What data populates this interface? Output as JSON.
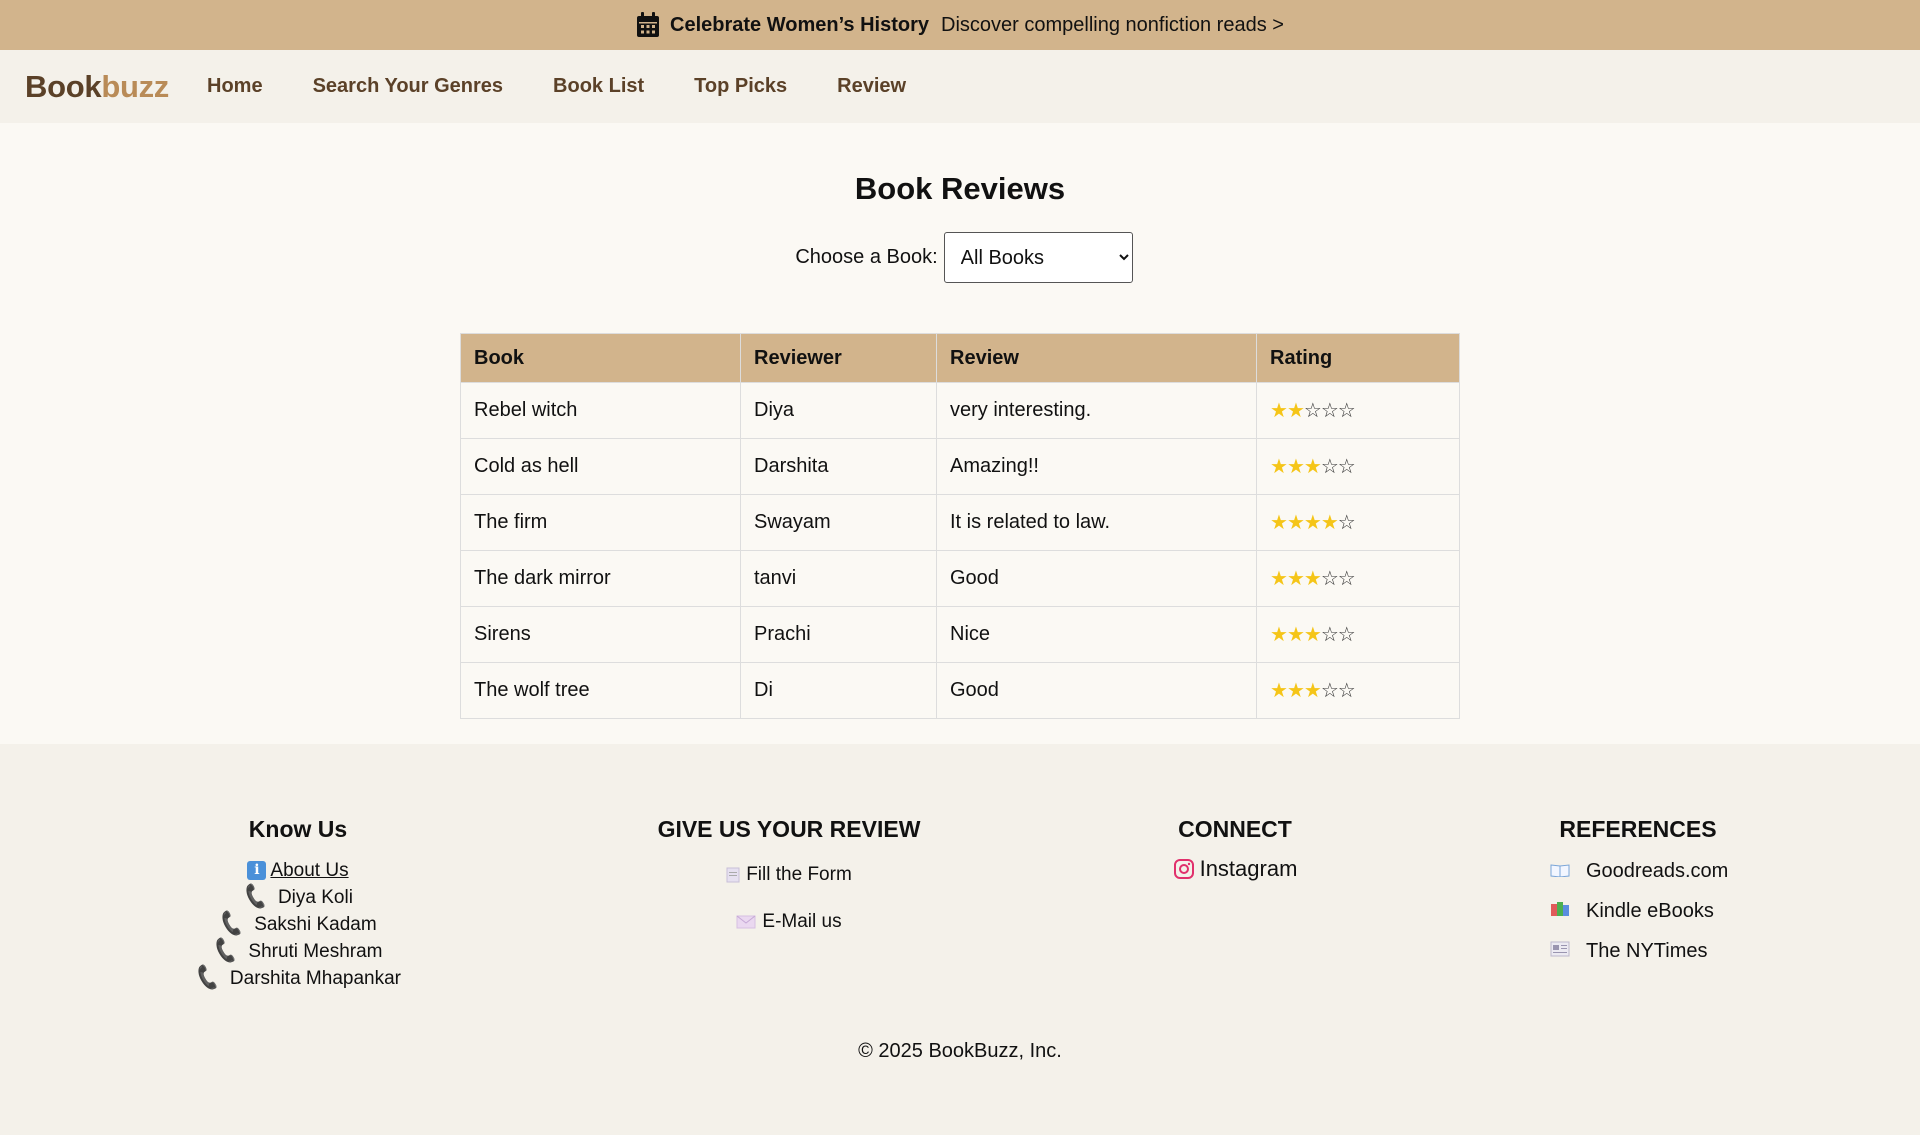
{
  "announcement": {
    "icon": "calendar-icon",
    "title": "Celebrate Women’s History",
    "link_text": "Discover compelling nonfiction reads >"
  },
  "nav": {
    "logo_part1": "Book",
    "logo_part2": "buzz",
    "links": [
      "Home",
      "Search Your Genres",
      "Book List",
      "Top Picks",
      "Review"
    ]
  },
  "main": {
    "title": "Book Reviews",
    "chooser_label": "Choose a Book:",
    "chooser_selected": "All Books"
  },
  "table": {
    "headers": [
      "Book",
      "Reviewer",
      "Review",
      "Rating"
    ],
    "rows": [
      {
        "book": "Rebel witch",
        "reviewer": "Diya",
        "review": "very interesting.",
        "rating": 2
      },
      {
        "book": "Cold as hell",
        "reviewer": "Darshita",
        "review": "Amazing!!",
        "rating": 3
      },
      {
        "book": "The firm",
        "reviewer": "Swayam",
        "review": "It is related to law.",
        "rating": 4
      },
      {
        "book": "The dark mirror",
        "reviewer": "tanvi",
        "review": "Good",
        "rating": 3
      },
      {
        "book": "Sirens",
        "reviewer": "Prachi",
        "review": "Nice",
        "rating": 3
      },
      {
        "book": "The wolf tree",
        "reviewer": "Di",
        "review": "Good",
        "rating": 3
      }
    ],
    "max_rating": 5
  },
  "footer": {
    "know_us": {
      "title": "Know Us",
      "about": "About Us",
      "people": [
        "Diya Koli",
        "Sakshi Kadam",
        "Shruti Meshram",
        "Darshita Mhapankar"
      ]
    },
    "review": {
      "title": "GIVE US YOUR REVIEW",
      "form": "Fill the Form",
      "email": "E-Mail us"
    },
    "connect": {
      "title": "CONNECT",
      "instagram": "Instagram"
    },
    "references": {
      "title": "REFERENCES",
      "items": [
        "Goodreads.com",
        "Kindle eBooks",
        "The NYTimes"
      ]
    },
    "copyright": "© 2025 BookBuzz, Inc."
  },
  "colors": {
    "accent": "#d2b48c",
    "brand_dark": "#5b4128",
    "brand_light": "#b98b57",
    "star": "#f5c518",
    "phone": "#d63384"
  }
}
